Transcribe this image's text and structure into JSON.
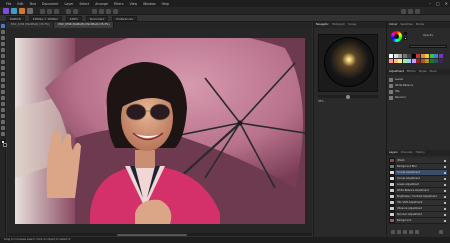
{
  "menubar": {
    "items": [
      "File",
      "Edit",
      "Text",
      "Document",
      "Layer",
      "Select",
      "Arrange",
      "Filters",
      "View",
      "Window",
      "Help"
    ]
  },
  "window_controls": {
    "minimize": "–",
    "maximize": "□",
    "close": "✕"
  },
  "context_bar": {
    "items": [
      "RGBA/8",
      "1560px × 1040px",
      "100%",
      "Document",
      "Preferences"
    ]
  },
  "tabs": [
    {
      "label": "DSC_1234 (Modified) (33.3%)",
      "active": false
    },
    {
      "label": "DSC_0796 (RGBA/8) (Modified) (25.3%)",
      "active": true
    }
  ],
  "panel_left": {
    "tabs": [
      "Navigator",
      "Histogram",
      "Scope"
    ],
    "zoom_value": "45%"
  },
  "panel_right": {
    "top_tabs": [
      "Colour",
      "Swatches",
      "Stroke"
    ],
    "opacity_label": "Opacity",
    "mid_tabs": [
      "Adjustment",
      "Effects",
      "Styles",
      "Stock"
    ],
    "adjustments": [
      "Levels",
      "White Balance",
      "HSL",
      "Recolour"
    ],
    "layer_tabs": [
      "Layers",
      "Channels",
      "History"
    ],
    "layers": [
      {
        "name": "(Pixel)",
        "selected": false
      },
      {
        "name": "Background Blur",
        "selected": false
      },
      {
        "name": "Curves Adjustment",
        "selected": true
      },
      {
        "name": "Curves Adjustment",
        "selected": false
      },
      {
        "name": "Levels Adjustment",
        "selected": false
      },
      {
        "name": "White Balance Adjustment",
        "selected": false
      },
      {
        "name": "Brightness / Contrast Adjustment",
        "selected": false
      },
      {
        "name": "HSL Shift Adjustment",
        "selected": false
      },
      {
        "name": "Vibrance Adjustment",
        "selected": false
      },
      {
        "name": "Recolour Adjustment",
        "selected": false
      },
      {
        "name": "Background",
        "selected": false
      }
    ]
  },
  "status": {
    "text": "Drag to marquee select. Click an object to select it."
  },
  "colors": {
    "accent": "#7a4fd8",
    "photo_background": "#7e3e57",
    "umbrella": "#c07a93",
    "jacket": "#d42e68",
    "selected_layer": "#3c4d6b"
  }
}
